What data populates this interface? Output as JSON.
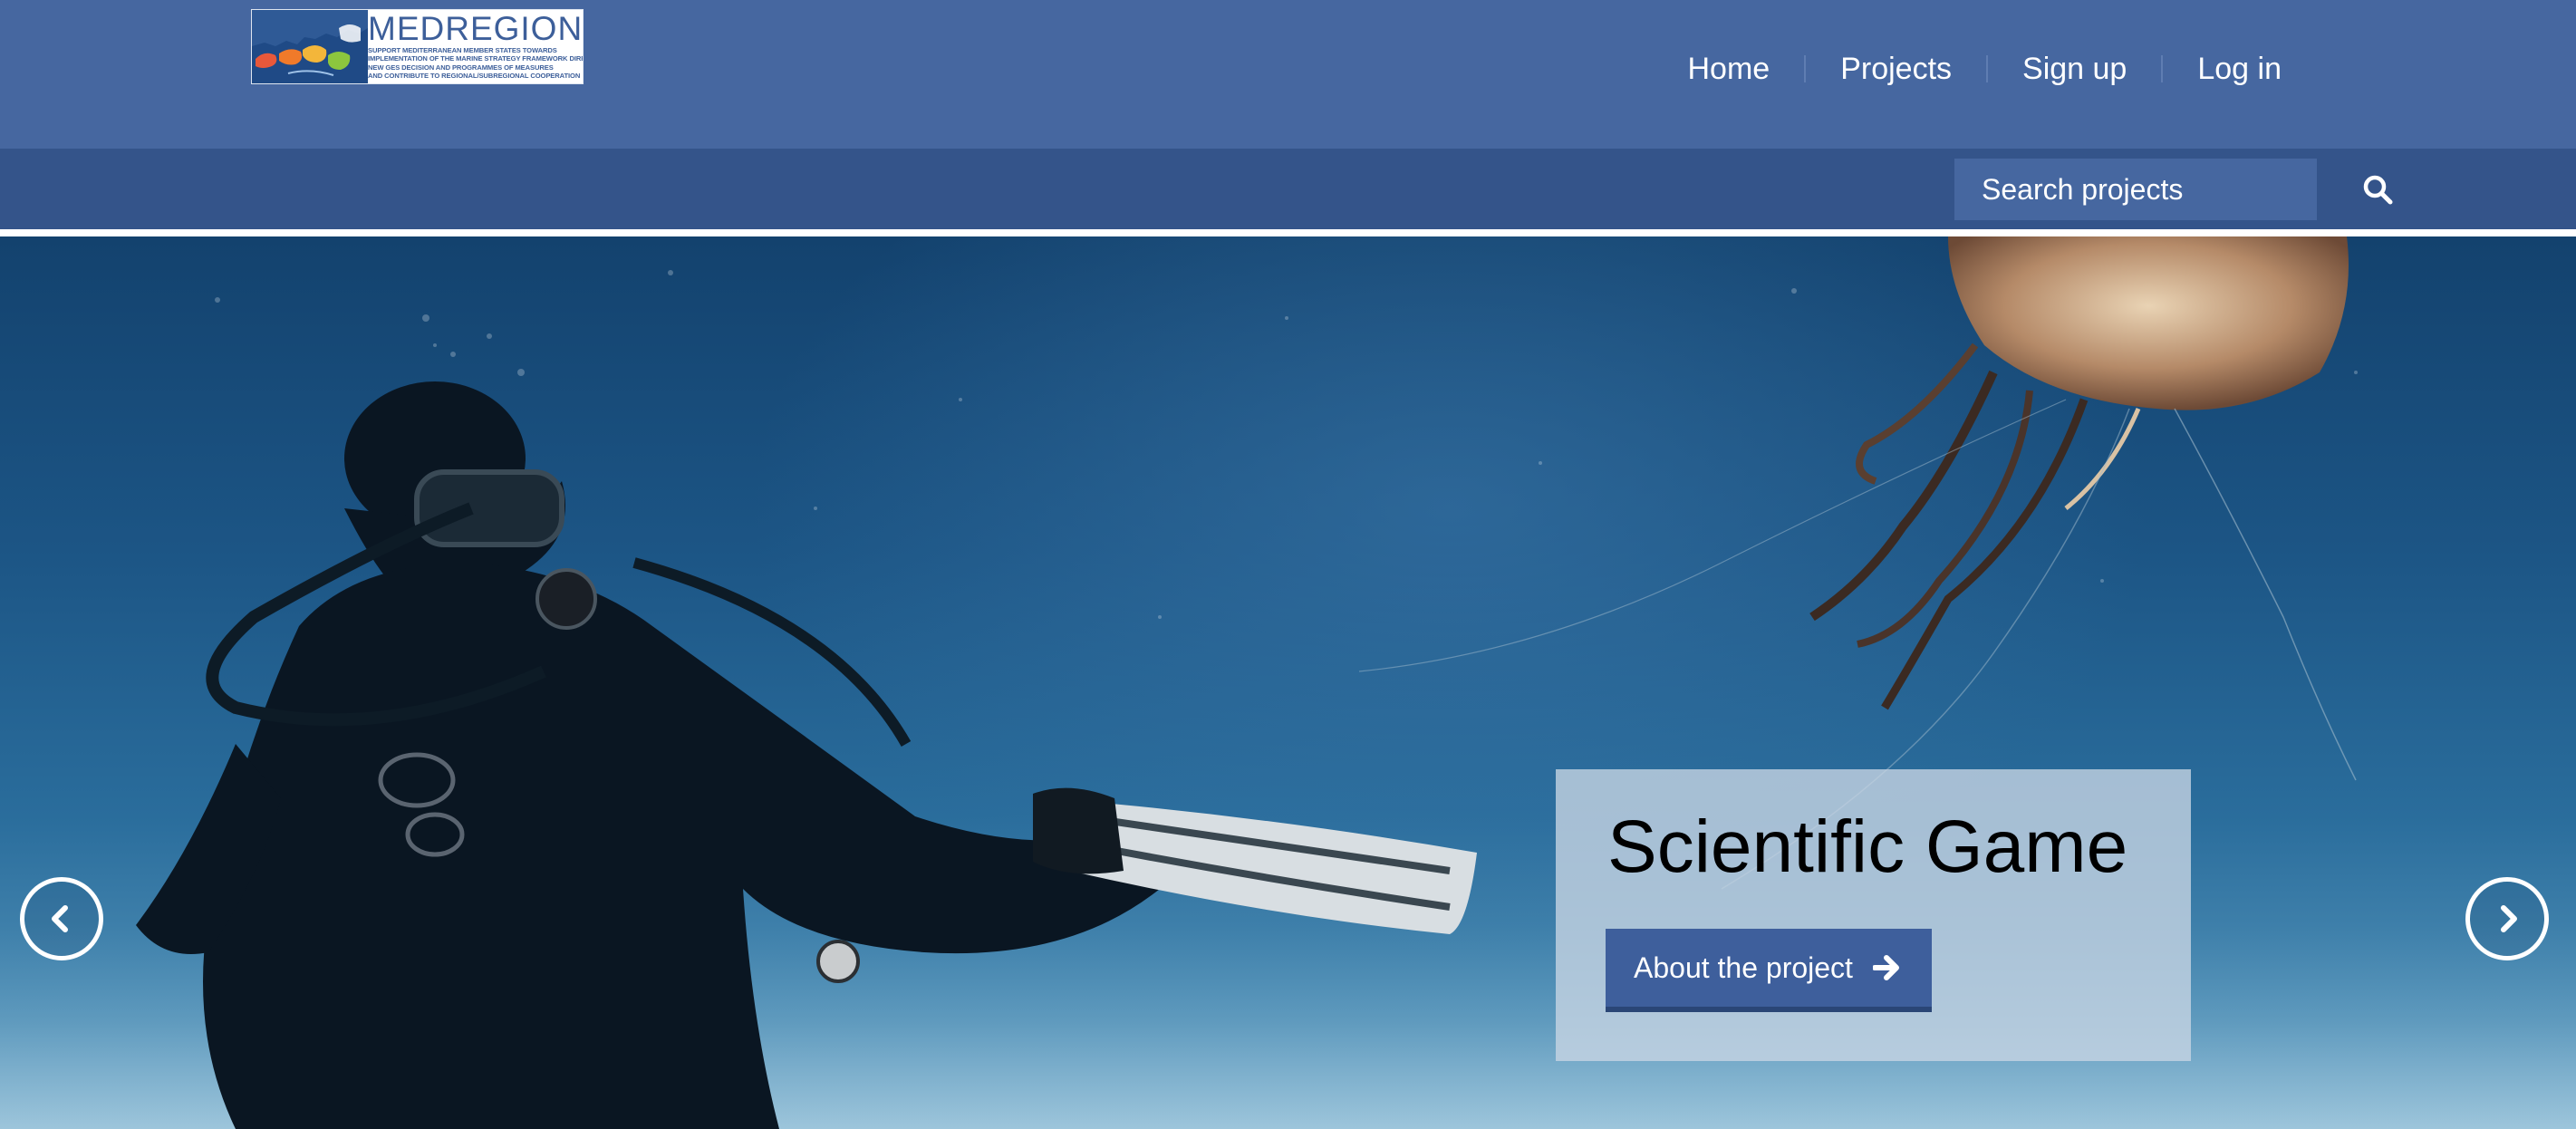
{
  "logo": {
    "title": "MEDREGION",
    "subtitle_lines": [
      "Support Mediterranean Member States towards",
      "implementation of the Marine Strategy Framework Directive",
      "new GES decision and programmes of measures",
      "and contribute to regional/subregional cooperation"
    ]
  },
  "nav": {
    "items": [
      "Home",
      "Projects",
      "Sign up",
      "Log in"
    ]
  },
  "search": {
    "placeholder": "Search projects"
  },
  "hero": {
    "caption_title": "Scientific Game",
    "button_label": "About the project"
  },
  "colors": {
    "header_bg": "#4667a0",
    "subbar_bg": "#34548a",
    "button_bg": "#3e5f9c"
  },
  "icons": {
    "search": "search-icon",
    "prev": "chevron-left-icon",
    "next": "chevron-right-icon",
    "button_arrow": "arrow-right-icon"
  }
}
